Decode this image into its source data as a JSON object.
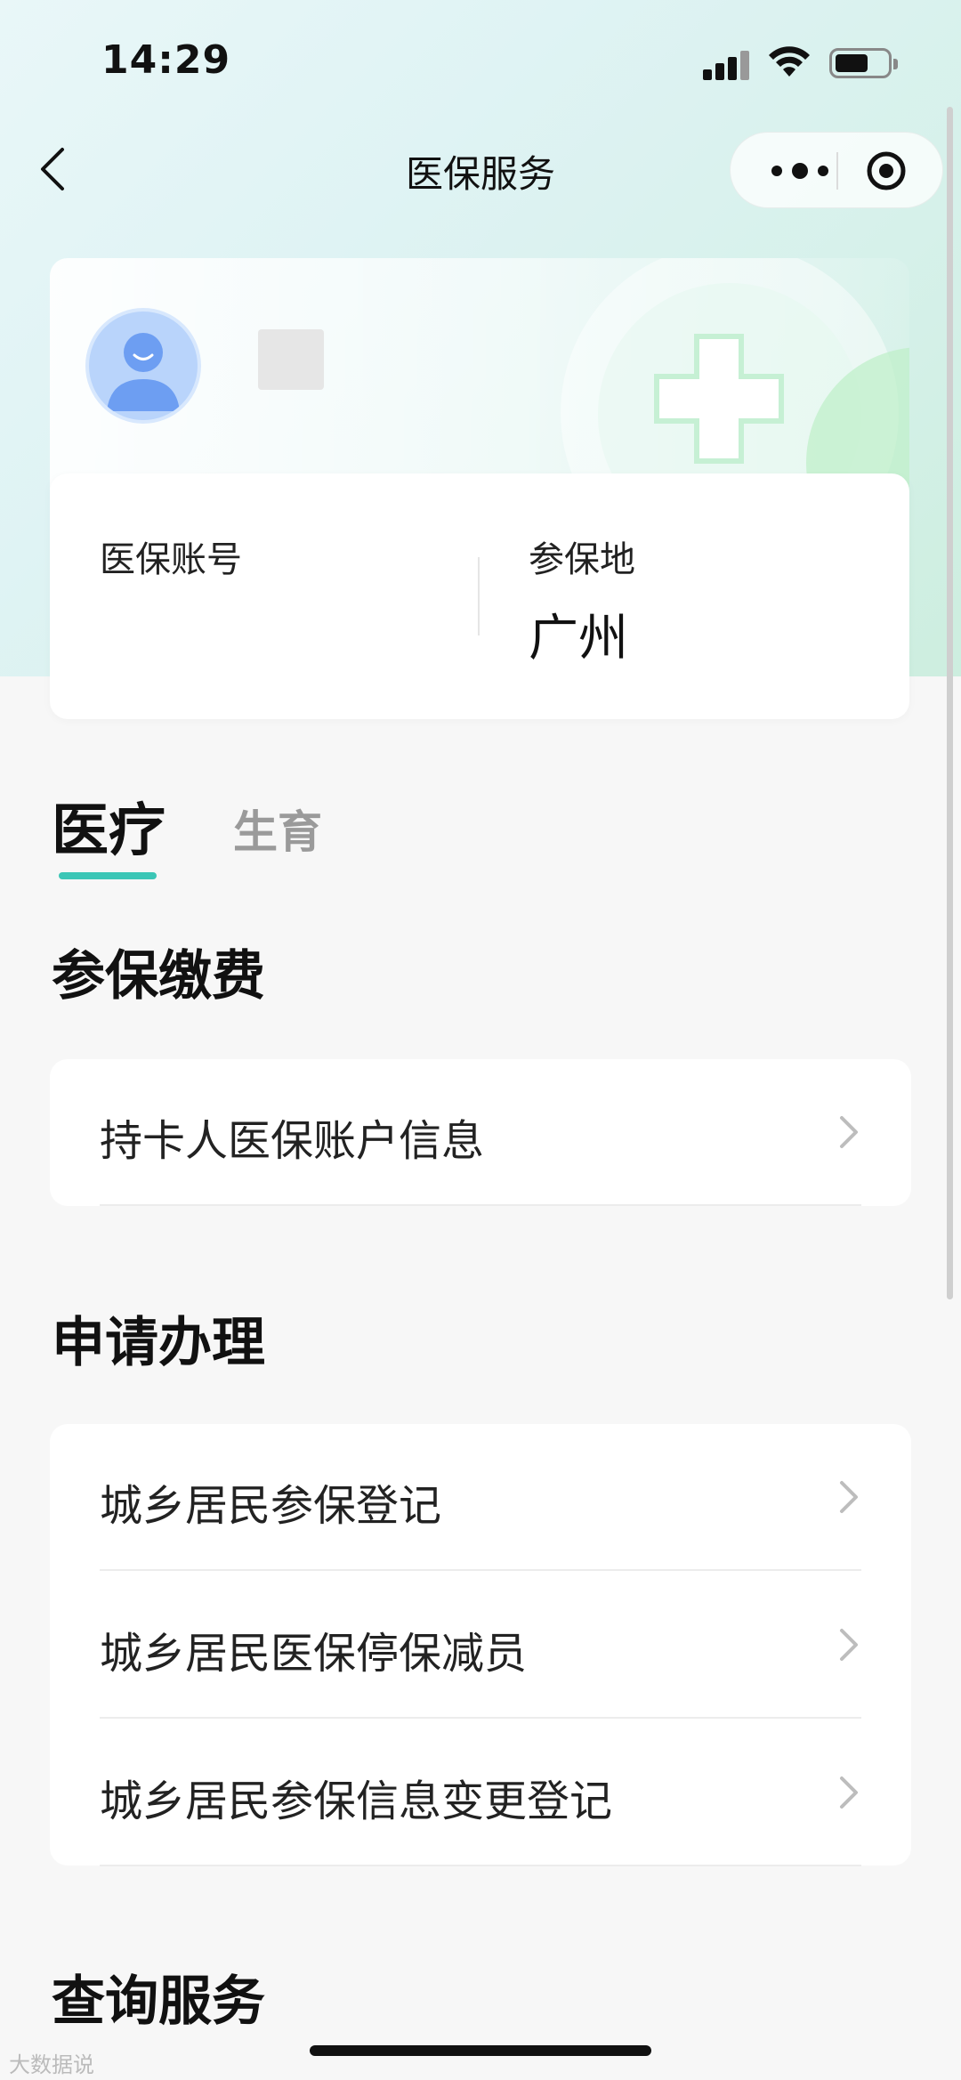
{
  "status_bar": {
    "time": "14:29"
  },
  "nav": {
    "title": "医保服务"
  },
  "profile": {
    "account_label": "医保账号",
    "region_label": "参保地",
    "region_value": "广州"
  },
  "tabs": [
    {
      "label": "医疗",
      "active": true
    },
    {
      "label": "生育",
      "active": false
    }
  ],
  "sections": [
    {
      "title": "参保缴费",
      "items": [
        "持卡人医保账户信息"
      ]
    },
    {
      "title": "申请办理",
      "items": [
        "城乡居民参保登记",
        "城乡居民医保停保减员",
        "城乡居民参保信息变更登记"
      ]
    },
    {
      "title": "查询服务",
      "items": []
    }
  ],
  "watermark": "大数据说",
  "colors": {
    "accent": "#3bc6b6",
    "text": "#222222",
    "muted": "#9a9a9a"
  }
}
